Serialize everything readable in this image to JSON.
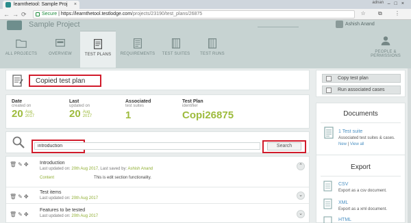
{
  "browser": {
    "tab_title": "learnthetool: Sample Proj",
    "tab_close": "×",
    "user_tag": "adnan",
    "window_controls": "–□×",
    "url_secure": "Secure",
    "url_host": "https://learnthetool.testlodge.com",
    "url_path": "/projects/23190/test_plans/26875",
    "nav_icons": [
      "←",
      "→",
      "⟳"
    ],
    "right_icons": "☆ ⧉ ⋮"
  },
  "header": {
    "project_title": "Sample Project",
    "user_name": "Ashish Anand"
  },
  "nav": {
    "items": [
      {
        "label": "ALL PROJECTS",
        "icon": "folder-icon"
      },
      {
        "label": "OVERVIEW",
        "icon": "overview-icon"
      },
      {
        "label": "TEST PLANS",
        "icon": "test-plans-icon",
        "active": true
      },
      {
        "label": "REQUIREMENTS",
        "icon": "requirements-icon"
      },
      {
        "label": "TEST SUITES",
        "icon": "test-suites-icon"
      },
      {
        "label": "TEST RUNS",
        "icon": "test-runs-icon"
      },
      {
        "label": "PEOPLE &",
        "label2": "PERMISSIONS",
        "icon": "people-icon"
      }
    ]
  },
  "plan": {
    "title": "Copied test plan"
  },
  "stats": {
    "date_created": {
      "heading": "Date",
      "sub": "created on",
      "day": "20",
      "month": "Aug",
      "year": "2017"
    },
    "last_updated": {
      "heading": "Last",
      "sub": "updated on",
      "day": "20",
      "month": "Aug",
      "year": "2017"
    },
    "associated": {
      "heading": "Associated",
      "sub": "test suites",
      "value": "1"
    },
    "identifier": {
      "heading": "Test Plan",
      "sub": "identifier",
      "value": "Copi26875"
    }
  },
  "search": {
    "value": "introduction",
    "button_label": "Search"
  },
  "sections": [
    {
      "title": "Introduction",
      "meta_prefix": "Last updated on: ",
      "meta_date": "20th Aug 2017",
      "meta_mid": ", Last saved by: ",
      "meta_user": "Ashish Anand",
      "content_label": "Content",
      "content_text": "This is edit section functionality."
    },
    {
      "title": "Test items",
      "meta_prefix": "Last updated on: ",
      "meta_date": "20th Aug 2017"
    },
    {
      "title": "Features to be tested",
      "meta_prefix": "Last updated on: ",
      "meta_date": "20th Aug 2017"
    }
  ],
  "actions": {
    "copy_label": "Copy test plan",
    "run_label": "Run associated cases"
  },
  "documents": {
    "heading": "Documents",
    "link": "1 Test suite",
    "desc": "Associated test suites & cases.",
    "new_label": "New",
    "sep": " | ",
    "view_all_label": "View all"
  },
  "export": {
    "heading": "Export",
    "items": [
      {
        "label": "CSV",
        "desc": "Export as a csv document."
      },
      {
        "label": "XML",
        "desc": "Export as a xml document."
      },
      {
        "label": "HTML",
        "desc": ""
      }
    ]
  },
  "colors": {
    "accent_green": "#9dbb3c",
    "highlight_red": "#d11a2a",
    "link_blue": "#4a90c2"
  }
}
